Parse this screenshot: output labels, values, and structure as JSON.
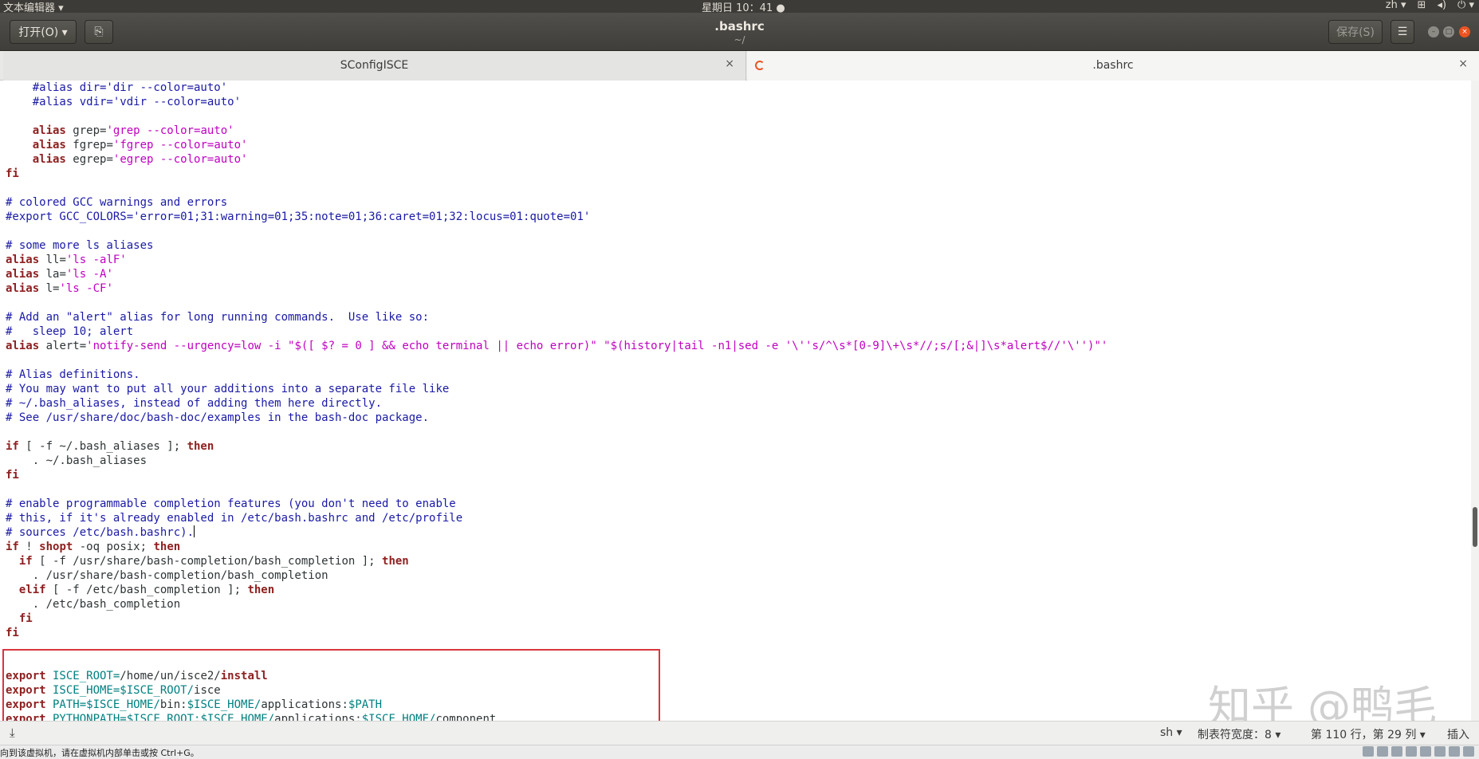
{
  "system_bar": {
    "app_menu": "文本编辑器 ▾",
    "clock": "星期日 10：41 ●",
    "lang": "zh ▾",
    "network_icon": "network-icon",
    "volume_icon": "volume-icon",
    "power_icon": "power-icon"
  },
  "header": {
    "open_label": "打开(O) ▾",
    "title": ".bashrc",
    "subtitle": "~/",
    "save_label": "保存(S)",
    "menu_label": "☰"
  },
  "tabs": [
    {
      "label": "SConfigISCE",
      "close": "×"
    },
    {
      "label": ".bashrc",
      "close": "×"
    }
  ],
  "editor": {
    "lines": [
      [
        [
          "    ",
          "p"
        ],
        [
          "#alias dir='dir --color=auto'",
          "c"
        ]
      ],
      [
        [
          "    ",
          "p"
        ],
        [
          "#alias vdir='vdir --color=auto'",
          "c"
        ]
      ],
      [
        [
          "",
          "p"
        ]
      ],
      [
        [
          "    ",
          "p"
        ],
        [
          "alias",
          "k"
        ],
        [
          " grep=",
          "p"
        ],
        [
          "'grep --color=auto'",
          "s"
        ]
      ],
      [
        [
          "    ",
          "p"
        ],
        [
          "alias",
          "k"
        ],
        [
          " fgrep=",
          "p"
        ],
        [
          "'fgrep --color=auto'",
          "s"
        ]
      ],
      [
        [
          "    ",
          "p"
        ],
        [
          "alias",
          "k"
        ],
        [
          " egrep=",
          "p"
        ],
        [
          "'egrep --color=auto'",
          "s"
        ]
      ],
      [
        [
          "fi",
          "k"
        ]
      ],
      [
        [
          "",
          "p"
        ]
      ],
      [
        [
          "# colored GCC warnings and errors",
          "c"
        ]
      ],
      [
        [
          "#export GCC_COLORS='error=01;31:warning=01;35:note=01;36:caret=01;32:locus=01:quote=01'",
          "c"
        ]
      ],
      [
        [
          "",
          "p"
        ]
      ],
      [
        [
          "# some more ls aliases",
          "c"
        ]
      ],
      [
        [
          "alias",
          "k"
        ],
        [
          " ll=",
          "p"
        ],
        [
          "'ls -alF'",
          "s"
        ]
      ],
      [
        [
          "alias",
          "k"
        ],
        [
          " la=",
          "p"
        ],
        [
          "'ls -A'",
          "s"
        ]
      ],
      [
        [
          "alias",
          "k"
        ],
        [
          " l=",
          "p"
        ],
        [
          "'ls -CF'",
          "s"
        ]
      ],
      [
        [
          "",
          "p"
        ]
      ],
      [
        [
          "# Add an \"alert\" alias for long running commands.  Use like so:",
          "c"
        ]
      ],
      [
        [
          "#   sleep 10; alert",
          "c"
        ]
      ],
      [
        [
          "alias",
          "k"
        ],
        [
          " alert=",
          "p"
        ],
        [
          "'notify-send --urgency=low -i \"$([ $? = 0 ] && echo terminal || echo error)\" \"$(history|tail -n1|sed -e '\\''s/^\\s*[0-9]\\+\\s*//;s/[;&|]\\s*alert$//'\\'')\"'",
          "s"
        ]
      ],
      [
        [
          "",
          "p"
        ]
      ],
      [
        [
          "# Alias definitions.",
          "c"
        ]
      ],
      [
        [
          "# You may want to put all your additions into a separate file like",
          "c"
        ]
      ],
      [
        [
          "# ~/.bash_aliases, instead of adding them here directly.",
          "c"
        ]
      ],
      [
        [
          "# See /usr/share/doc/bash-doc/examples in the bash-doc package.",
          "c"
        ]
      ],
      [
        [
          "",
          "p"
        ]
      ],
      [
        [
          "if",
          "k"
        ],
        [
          " [ -f ~/.bash_aliases ]; ",
          "p"
        ],
        [
          "then",
          "k"
        ]
      ],
      [
        [
          "    . ~/.bash_aliases",
          "p"
        ]
      ],
      [
        [
          "fi",
          "k"
        ]
      ],
      [
        [
          "",
          "p"
        ]
      ],
      [
        [
          "# enable programmable completion features (you don't need to enable",
          "c"
        ]
      ],
      [
        [
          "# this, if it's already enabled in /etc/bash.bashrc and /etc/profile",
          "c"
        ]
      ],
      [
        [
          "# sources /etc/bash.bashrc).",
          "c"
        ]
      ],
      [
        [
          "if",
          "k"
        ],
        [
          " ! ",
          "p"
        ],
        [
          "shopt",
          "k"
        ],
        [
          " -oq posix; ",
          "p"
        ],
        [
          "then",
          "k"
        ]
      ],
      [
        [
          "  ",
          "p"
        ],
        [
          "if",
          "k"
        ],
        [
          " [ -f /usr/share/bash-completion/bash_completion ]; ",
          "p"
        ],
        [
          "then",
          "k"
        ]
      ],
      [
        [
          "    . /usr/share/bash-completion/bash_completion",
          "p"
        ]
      ],
      [
        [
          "  ",
          "p"
        ],
        [
          "elif",
          "k"
        ],
        [
          " [ -f /etc/bash_completion ]; ",
          "p"
        ],
        [
          "then",
          "k"
        ]
      ],
      [
        [
          "    . /etc/bash_completion",
          "p"
        ]
      ],
      [
        [
          "  ",
          "p"
        ],
        [
          "fi",
          "k"
        ]
      ],
      [
        [
          "fi",
          "k"
        ]
      ],
      [
        [
          "",
          "p"
        ]
      ],
      [
        [
          "",
          "p"
        ]
      ],
      [
        [
          "export",
          "k"
        ],
        [
          " ISCE_ROOT=",
          "v"
        ],
        [
          "/home/un/isce2/",
          "p"
        ],
        [
          "install",
          "k"
        ]
      ],
      [
        [
          "export",
          "k"
        ],
        [
          " ISCE_HOME=$ISCE_ROOT/",
          "v"
        ],
        [
          "isce",
          "p"
        ]
      ],
      [
        [
          "export",
          "k"
        ],
        [
          " PATH=$ISCE_HOME/",
          "v"
        ],
        [
          "bin:",
          "p"
        ],
        [
          "$ISCE_HOME/",
          "v"
        ],
        [
          "applications:",
          "p"
        ],
        [
          "$PATH",
          "v"
        ]
      ],
      [
        [
          "export",
          "k"
        ],
        [
          " PYTHONPATH=$ISCE_ROOT:$ISCE_HOME/",
          "v"
        ],
        [
          "applications:",
          "p"
        ],
        [
          "$ISCE_HOME/",
          "v"
        ],
        [
          "component",
          "p"
        ]
      ]
    ],
    "cursor_line": 31
  },
  "watermark": "知乎 @鸭毛",
  "status_bar": {
    "lang": "sh ▾",
    "tab_width": "制表符宽度：8 ▾",
    "position": "第 110 行，第 29 列 ▾",
    "mode": "插入"
  },
  "vm_bar": {
    "hint": "向到该虚拟机，请在虚拟机内部单击或按 Ctrl+G。"
  },
  "colors": {
    "comment": "#1a1aa6",
    "keyword": "#8f2020",
    "string": "#c000c0",
    "variable": "#008080",
    "highlight": "#d9363e"
  }
}
